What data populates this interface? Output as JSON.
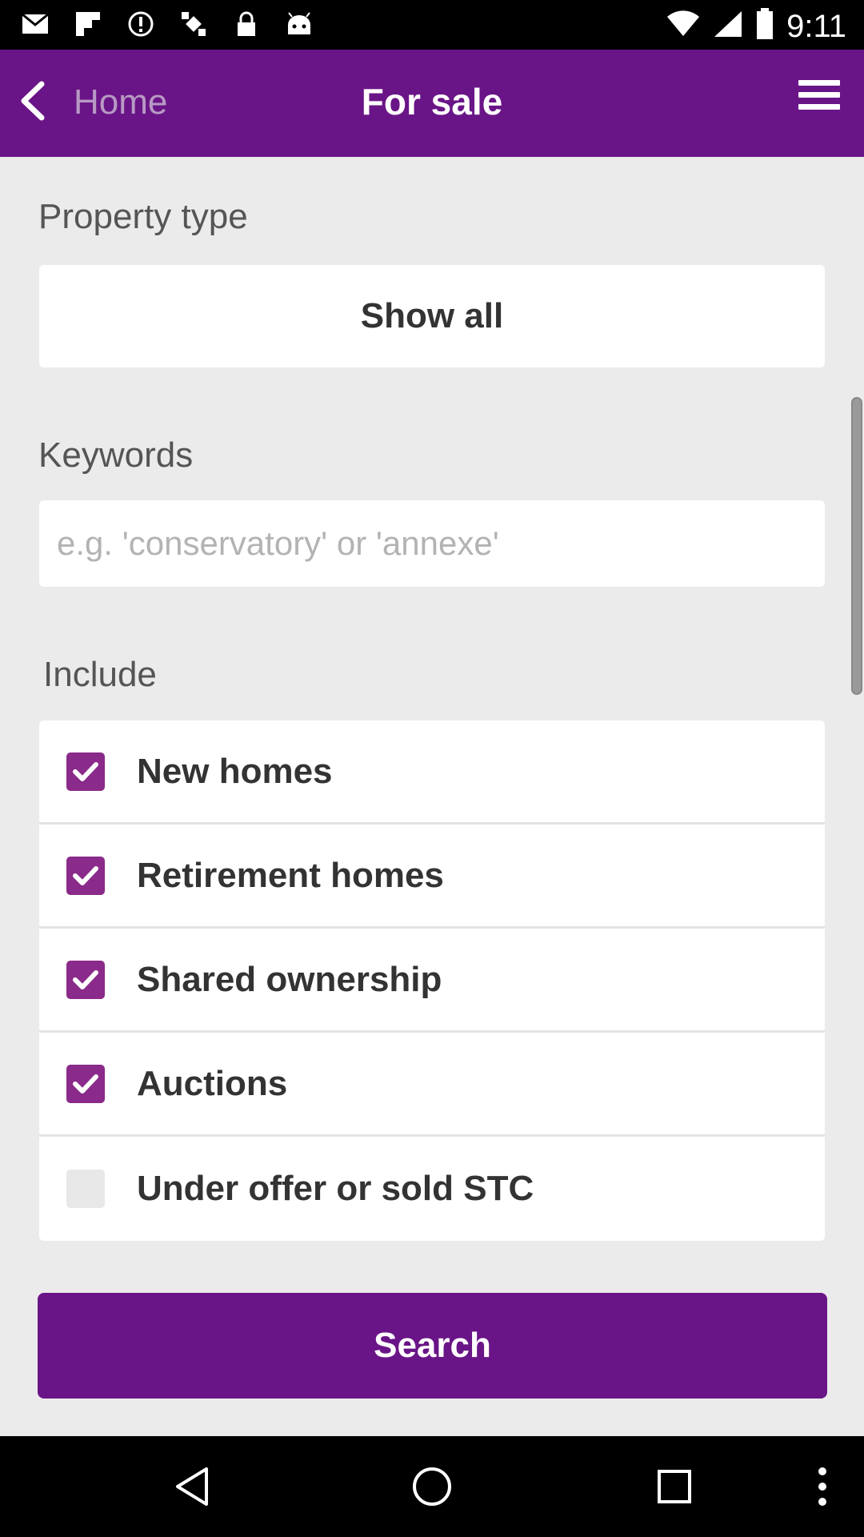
{
  "status_bar": {
    "time": "9:11",
    "icons": [
      "mail-icon",
      "flipboard-icon",
      "alert-icon",
      "satellite-icon",
      "lock-icon",
      "android-icon",
      "wifi-icon",
      "signal-icon",
      "battery-icon"
    ]
  },
  "app_bar": {
    "back_label": "Home",
    "title": "For sale",
    "menu_icon": "hamburger-menu-icon"
  },
  "form": {
    "property_type_label": "Property type",
    "property_type_value": "Show all",
    "keywords_label": "Keywords",
    "keywords_value": "",
    "keywords_placeholder": "e.g. 'conservatory' or 'annexe'",
    "include_label": "Include",
    "include_items": [
      {
        "label": "New homes",
        "checked": true
      },
      {
        "label": "Retirement homes",
        "checked": true
      },
      {
        "label": "Shared ownership",
        "checked": true
      },
      {
        "label": "Auctions",
        "checked": true
      },
      {
        "label": "Under offer or sold STC",
        "checked": false
      }
    ],
    "search_label": "Search"
  },
  "nav_bar": {
    "icons": [
      "back-triangle-icon",
      "home-circle-icon",
      "recents-square-icon",
      "overflow-dots-icon"
    ]
  },
  "colors": {
    "primary": "#6a1587",
    "checkbox_checked": "#8a2a8a",
    "background": "#ebebeb"
  }
}
